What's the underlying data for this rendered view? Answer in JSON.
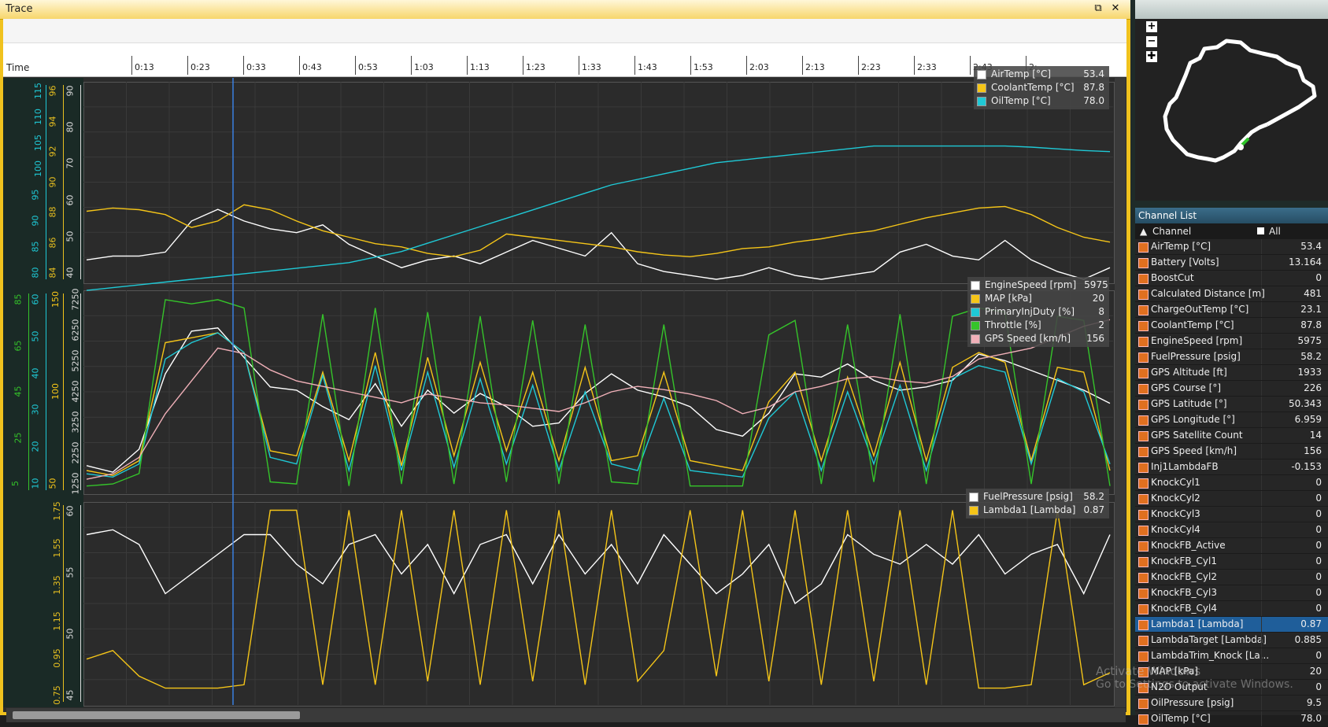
{
  "trace_window": {
    "title": "Trace",
    "restore_icon": "restore-icon",
    "close_icon": "close-icon"
  },
  "time_axis": {
    "label": "Time",
    "ticks": [
      "0:13",
      "0:23",
      "0:33",
      "0:43",
      "0:53",
      "1:03",
      "1:13",
      "1:23",
      "1:33",
      "1:43",
      "1:53",
      "2:03",
      "2:13",
      "2:23",
      "2:33",
      "2:43",
      "2:"
    ]
  },
  "cursor_time": "0:31",
  "panels": [
    {
      "legend": [
        {
          "name": "AirTemp [°C]",
          "value": "53.4",
          "color": "#ffffff"
        },
        {
          "name": "CoolantTemp [°C]",
          "value": "87.8",
          "color": "#f5c518"
        },
        {
          "name": "OilTemp [°C]",
          "value": "78.0",
          "color": "#1fc9d6"
        }
      ],
      "axes": [
        {
          "color": "#1fc9d6",
          "ticks": [
            "80",
            "85",
            "90",
            "95",
            "100",
            "105",
            "110",
            "115"
          ]
        },
        {
          "color": "#e8c020",
          "ticks": [
            "84",
            "86",
            "88",
            "90",
            "92",
            "94",
            "96"
          ]
        },
        {
          "color": "#dddddd",
          "ticks": [
            "40",
            "50",
            "60",
            "70",
            "80",
            "90"
          ]
        }
      ]
    },
    {
      "legend": [
        {
          "name": "EngineSpeed [rpm]",
          "value": "5975",
          "color": "#ffffff"
        },
        {
          "name": "MAP [kPa]",
          "value": "20",
          "color": "#f5c518"
        },
        {
          "name": "PrimaryInjDuty [%]",
          "value": "8",
          "color": "#1fc9d6"
        },
        {
          "name": "Throttle [%]",
          "value": "2",
          "color": "#35c42a"
        },
        {
          "name": "GPS Speed [km/h]",
          "value": "156",
          "color": "#f0b0b8"
        }
      ],
      "axes": [
        {
          "color": "#35c42a",
          "ticks": [
            "5",
            "25",
            "45",
            "65",
            "85"
          ]
        },
        {
          "color": "#1fc9d6",
          "ticks": [
            "10",
            "20",
            "30",
            "40",
            "50",
            "60"
          ]
        },
        {
          "color": "#f5c518",
          "ticks": [
            "50",
            "100",
            "150"
          ]
        },
        {
          "color": "#dddddd",
          "ticks": [
            "1250",
            "2250",
            "3250",
            "4250",
            "5250",
            "6250",
            "7250"
          ]
        }
      ]
    },
    {
      "legend": [
        {
          "name": "FuelPressure [psig]",
          "value": "58.2",
          "color": "#ffffff"
        },
        {
          "name": "Lambda1 [Lambda]",
          "value": "0.87",
          "color": "#f5c518"
        }
      ],
      "axes": [
        {
          "color": "#e8c020",
          "ticks": [
            "0.75",
            "0.95",
            "1.15",
            "1.35",
            "1.55",
            "1.75"
          ]
        },
        {
          "color": "#dddddd",
          "ticks": [
            "45",
            "50",
            "55",
            "60"
          ]
        }
      ]
    }
  ],
  "chart_data": [
    {
      "type": "line",
      "x_unit": "time",
      "series": [
        {
          "name": "AirTemp [°C]",
          "color": "#ffffff",
          "y_axis_range": [
            40,
            90
          ],
          "values": [
            45,
            46,
            46,
            47,
            55,
            58,
            55,
            53,
            52,
            54,
            49,
            46,
            43,
            45,
            46,
            44,
            47,
            50,
            48,
            46,
            52,
            44,
            42,
            41,
            40,
            41,
            43,
            41,
            40,
            41,
            42,
            47,
            49,
            46,
            45,
            50,
            45,
            42,
            40,
            43
          ]
        },
        {
          "name": "CoolantTemp [°C]",
          "color": "#f5c518",
          "y_axis_range": [
            84,
            96
          ],
          "values": [
            88.2,
            88.4,
            88.3,
            88.0,
            87.2,
            87.6,
            88.6,
            88.3,
            87.6,
            87.0,
            86.6,
            86.2,
            86.0,
            85.6,
            85.4,
            85.8,
            86.8,
            86.6,
            86.4,
            86.2,
            86.0,
            85.7,
            85.5,
            85.4,
            85.6,
            85.9,
            86.0,
            86.3,
            86.5,
            86.8,
            87.0,
            87.4,
            87.8,
            88.1,
            88.4,
            88.5,
            88.0,
            87.2,
            86.6,
            86.3
          ]
        },
        {
          "name": "OilTemp [°C]",
          "color": "#1fc9d6",
          "y_axis_range": [
            80,
            115
          ],
          "values": [
            78,
            78.5,
            79,
            79.5,
            80,
            80.5,
            81,
            81.5,
            82,
            82.5,
            83,
            84,
            85,
            86.5,
            88,
            89.5,
            91,
            92.5,
            94,
            95.5,
            97,
            98,
            99,
            100,
            101,
            101.5,
            102,
            102.5,
            103,
            103.5,
            104,
            104,
            104,
            104,
            104,
            104,
            103.8,
            103.5,
            103.2,
            103
          ]
        }
      ]
    },
    {
      "type": "line",
      "x_unit": "time",
      "series": [
        {
          "name": "EngineSpeed [rpm]",
          "color": "#ffffff",
          "y_axis_range": [
            1250,
            7250
          ],
          "values": [
            2000,
            1800,
            2500,
            4800,
            6100,
            6200,
            5300,
            4400,
            4300,
            3800,
            3400,
            4500,
            3200,
            4300,
            3600,
            4200,
            3800,
            3200,
            3300,
            4200,
            4800,
            4300,
            4100,
            3800,
            3100,
            2900,
            3600,
            4800,
            4700,
            5100,
            4600,
            4300,
            4400,
            4600,
            5400,
            5200,
            4900,
            4600,
            4300,
            3900
          ]
        },
        {
          "name": "MAP [kPa]",
          "color": "#f5c518",
          "y_axis_range": [
            0,
            200
          ],
          "values": [
            20,
            15,
            30,
            150,
            155,
            160,
            140,
            40,
            35,
            120,
            30,
            140,
            25,
            135,
            35,
            130,
            40,
            120,
            30,
            125,
            30,
            35,
            120,
            30,
            25,
            20,
            90,
            120,
            30,
            115,
            35,
            130,
            30,
            125,
            140,
            130,
            30,
            125,
            120,
            20
          ]
        },
        {
          "name": "PrimaryInjDuty [%]",
          "color": "#1fc9d6",
          "y_axis_range": [
            0,
            60
          ],
          "values": [
            5,
            4,
            8,
            40,
            45,
            48,
            42,
            10,
            8,
            35,
            6,
            38,
            6,
            36,
            7,
            34,
            8,
            32,
            6,
            30,
            8,
            6,
            28,
            6,
            5,
            4,
            22,
            30,
            6,
            30,
            8,
            32,
            6,
            34,
            38,
            36,
            8,
            34,
            30,
            8
          ]
        },
        {
          "name": "Throttle [%]",
          "color": "#35c42a",
          "y_axis_range": [
            0,
            95
          ],
          "values": [
            2,
            3,
            8,
            92,
            90,
            92,
            88,
            4,
            3,
            85,
            2,
            88,
            3,
            86,
            3,
            84,
            4,
            82,
            3,
            80,
            4,
            3,
            80,
            2,
            2,
            2,
            75,
            82,
            3,
            80,
            4,
            85,
            3,
            84,
            88,
            86,
            3,
            84,
            82,
            2
          ]
        },
        {
          "name": "GPS Speed [km/h]",
          "color": "#f0b0b8",
          "y_axis_range": [
            0,
            180
          ],
          "values": [
            10,
            15,
            30,
            70,
            100,
            130,
            125,
            110,
            100,
            95,
            90,
            85,
            80,
            88,
            84,
            80,
            78,
            75,
            72,
            80,
            90,
            95,
            92,
            88,
            82,
            70,
            76,
            90,
            95,
            102,
            104,
            100,
            98,
            104,
            120,
            125,
            130,
            140,
            150,
            156
          ]
        }
      ]
    },
    {
      "type": "line",
      "x_unit": "time",
      "series": [
        {
          "name": "FuelPressure [psig]",
          "color": "#ffffff",
          "y_axis_range": [
            41,
            61
          ],
          "values": [
            58,
            58.5,
            57,
            52,
            54,
            56,
            58,
            58,
            55,
            53,
            57,
            58,
            54,
            57,
            52,
            57,
            58,
            53,
            58,
            54,
            57,
            53,
            58,
            55,
            52,
            54,
            57,
            51,
            53,
            58,
            56,
            55,
            57,
            55,
            58,
            54,
            56,
            57,
            52,
            58
          ]
        },
        {
          "name": "Lambda1 [Lambda]",
          "color": "#f5c518",
          "y_axis_range": [
            0.7,
            1.85
          ],
          "values": [
            0.95,
            1.0,
            0.85,
            0.78,
            0.78,
            0.78,
            0.8,
            1.82,
            1.82,
            0.8,
            1.82,
            0.8,
            1.82,
            0.82,
            1.82,
            0.8,
            1.82,
            0.82,
            1.82,
            0.8,
            1.82,
            0.82,
            1.0,
            1.82,
            0.85,
            1.82,
            0.82,
            1.82,
            0.8,
            1.82,
            0.82,
            1.82,
            0.8,
            1.82,
            0.78,
            0.78,
            0.8,
            1.82,
            0.8,
            0.87
          ]
        }
      ]
    }
  ],
  "map": {
    "zoom_in": "+",
    "zoom_out": "−",
    "fit": "✚"
  },
  "channel_list": {
    "title": "Channel List",
    "header_channel": "Channel",
    "header_all": "All",
    "rows": [
      {
        "name": "AirTemp [°C]",
        "value": "53.4"
      },
      {
        "name": "Battery [Volts]",
        "value": "13.164"
      },
      {
        "name": "BoostCut",
        "value": "0"
      },
      {
        "name": "Calculated Distance [m]",
        "value": "481"
      },
      {
        "name": "ChargeOutTemp [°C]",
        "value": "23.1"
      },
      {
        "name": "CoolantTemp [°C]",
        "value": "87.8"
      },
      {
        "name": "EngineSpeed [rpm]",
        "value": "5975"
      },
      {
        "name": "FuelPressure [psig]",
        "value": "58.2"
      },
      {
        "name": "GPS Altitude [ft]",
        "value": "1933"
      },
      {
        "name": "GPS Course [°]",
        "value": "226"
      },
      {
        "name": "GPS Latitude [°]",
        "value": "50.343"
      },
      {
        "name": "GPS Longitude [°]",
        "value": "6.959"
      },
      {
        "name": "GPS Satellite Count",
        "value": "14"
      },
      {
        "name": "GPS Speed [km/h]",
        "value": "156"
      },
      {
        "name": "Inj1LambdaFB",
        "value": "-0.153"
      },
      {
        "name": "KnockCyl1",
        "value": "0"
      },
      {
        "name": "KnockCyl2",
        "value": "0"
      },
      {
        "name": "KnockCyl3",
        "value": "0"
      },
      {
        "name": "KnockCyl4",
        "value": "0"
      },
      {
        "name": "KnockFB_Active",
        "value": "0"
      },
      {
        "name": "KnockFB_Cyl1",
        "value": "0"
      },
      {
        "name": "KnockFB_Cyl2",
        "value": "0"
      },
      {
        "name": "KnockFB_Cyl3",
        "value": "0"
      },
      {
        "name": "KnockFB_Cyl4",
        "value": "0"
      },
      {
        "name": "Lambda1 [Lambda]",
        "value": "0.87",
        "selected": true
      },
      {
        "name": "LambdaTarget [Lambda]",
        "value": "0.885"
      },
      {
        "name": "LambdaTrim_Knock [La...",
        "value": "0"
      },
      {
        "name": "MAP [kPa]",
        "value": "20"
      },
      {
        "name": "N2O Output",
        "value": "0"
      },
      {
        "name": "OilPressure [psig]",
        "value": "9.5"
      },
      {
        "name": "OilTemp [°C]",
        "value": "78.0"
      }
    ]
  },
  "watermark": {
    "line1": "Activate Windows",
    "line2": "Go to Settings to activate Windows."
  }
}
